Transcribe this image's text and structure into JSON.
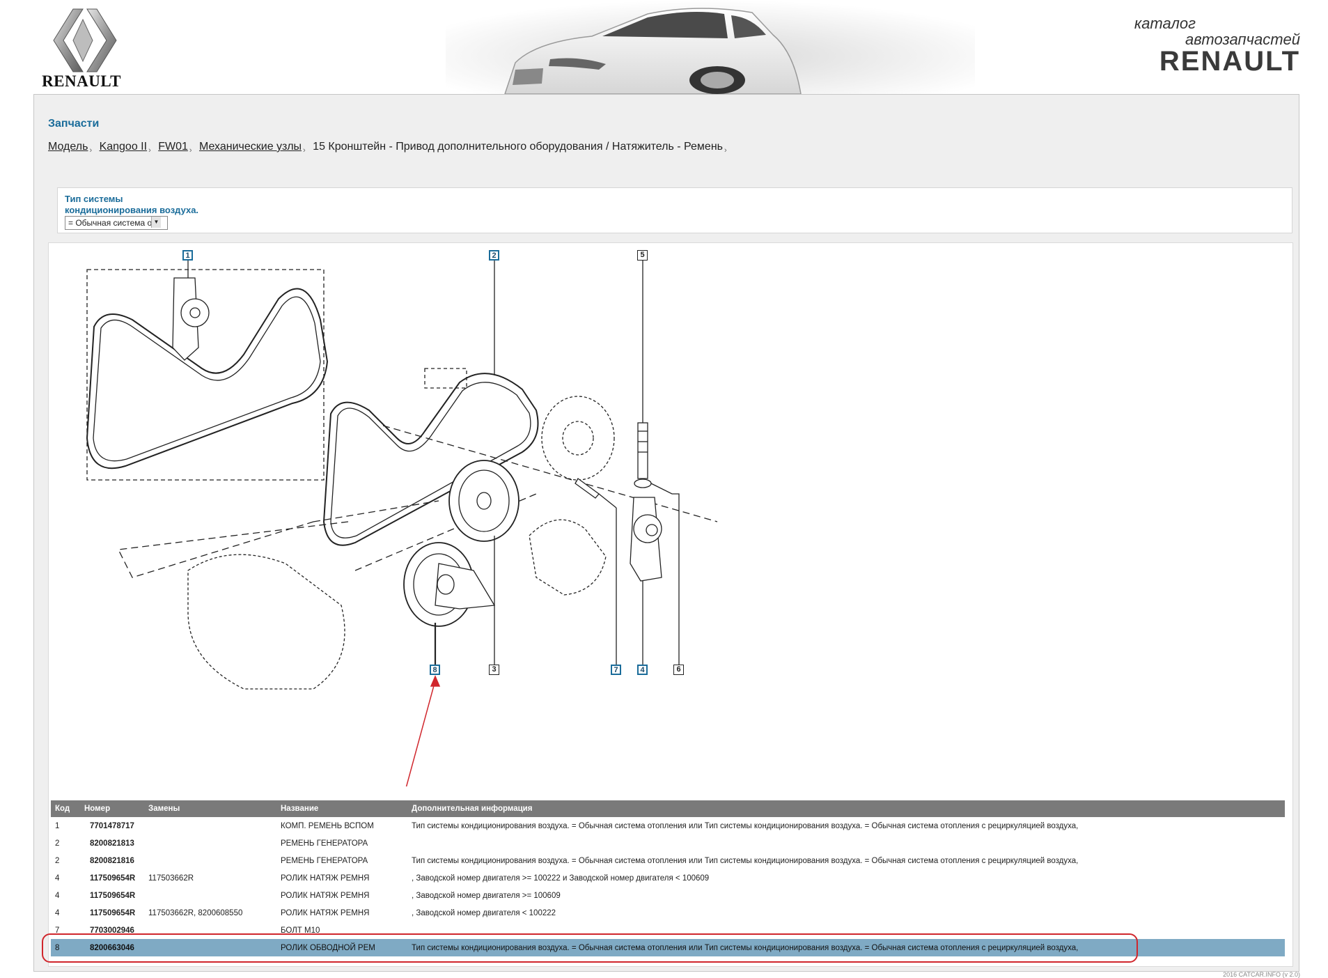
{
  "header": {
    "logo_text": "RENAULT",
    "catalog_line1": "каталог",
    "catalog_line2": "автозапчастей",
    "catalog_brand": "RENAULT"
  },
  "page": {
    "section_title": "Запчасти",
    "breadcrumb": [
      {
        "label": "Модель",
        "link": true
      },
      {
        "label": "Kangoo II",
        "link": true
      },
      {
        "label": "FW01",
        "link": true
      },
      {
        "label": "Механические узлы",
        "link": true
      },
      {
        "label": "15 Кронштейн - Привод дополнительного оборудования / Натяжитель - Ремень",
        "link": false
      }
    ],
    "breadcrumb_separator": "›"
  },
  "filter": {
    "label_line1": "Тип системы",
    "label_line2": "кондиционирования воздуха.",
    "selected_value": "= Обычная система о"
  },
  "diagram": {
    "callouts": [
      "1",
      "2",
      "5",
      "8",
      "3",
      "7",
      "4",
      "6"
    ]
  },
  "table": {
    "headers": [
      "Код",
      "Номер",
      "Замены",
      "Название",
      "Дополнительная информация"
    ],
    "rows": [
      {
        "code": "1",
        "number": "7701478717",
        "replacements": "",
        "name": "КОМП. РЕМЕНЬ ВСПОМ",
        "info": "Тип системы кондиционирования воздуха. = Обычная система отопления или Тип системы кондиционирования воздуха. = Обычная система отопления с рециркуляцией воздуха,"
      },
      {
        "code": "2",
        "number": "8200821813",
        "replacements": "",
        "name": "РЕМЕНЬ ГЕНЕРАТОРА",
        "info": ""
      },
      {
        "code": "2",
        "number": "8200821816",
        "replacements": "",
        "name": "РЕМЕНЬ ГЕНЕРАТОРА",
        "info": "Тип системы кондиционирования воздуха. = Обычная система отопления или Тип системы кондиционирования воздуха. = Обычная система отопления с рециркуляцией воздуха,"
      },
      {
        "code": "4",
        "number": "117509654R",
        "replacements": "117503662R",
        "name": "РОЛИК НАТЯЖ РЕМНЯ",
        "info": ", Заводской номер двигателя >= 100222 и Заводской номер двигателя < 100609"
      },
      {
        "code": "4",
        "number": "117509654R",
        "replacements": "",
        "name": "РОЛИК НАТЯЖ РЕМНЯ",
        "info": ", Заводской номер двигателя >= 100609"
      },
      {
        "code": "4",
        "number": "117509654R",
        "replacements": "117503662R, 8200608550",
        "name": "РОЛИК НАТЯЖ РЕМНЯ",
        "info": ", Заводской номер двигателя < 100222"
      },
      {
        "code": "7",
        "number": "7703002946",
        "replacements": "",
        "name": "БОЛТ M10",
        "info": ""
      },
      {
        "code": "8",
        "number": "8200663046",
        "replacements": "",
        "name": "РОЛИК ОБВОДНОЙ РЕМ",
        "info": "Тип системы кондиционирования воздуха. = Обычная система отопления или Тип системы кондиционирования воздуха. = Обычная система отопления с рециркуляцией воздуха,"
      }
    ],
    "selected_row": 7
  },
  "footer": {
    "credit": "2016 CATCAR.INFO (v 2.0)"
  },
  "colors": {
    "accent": "#1a6c9a",
    "table_header_bg": "#7a7a7a",
    "selected_row_bg": "#7faac4",
    "annotation_red": "#d0262c"
  }
}
